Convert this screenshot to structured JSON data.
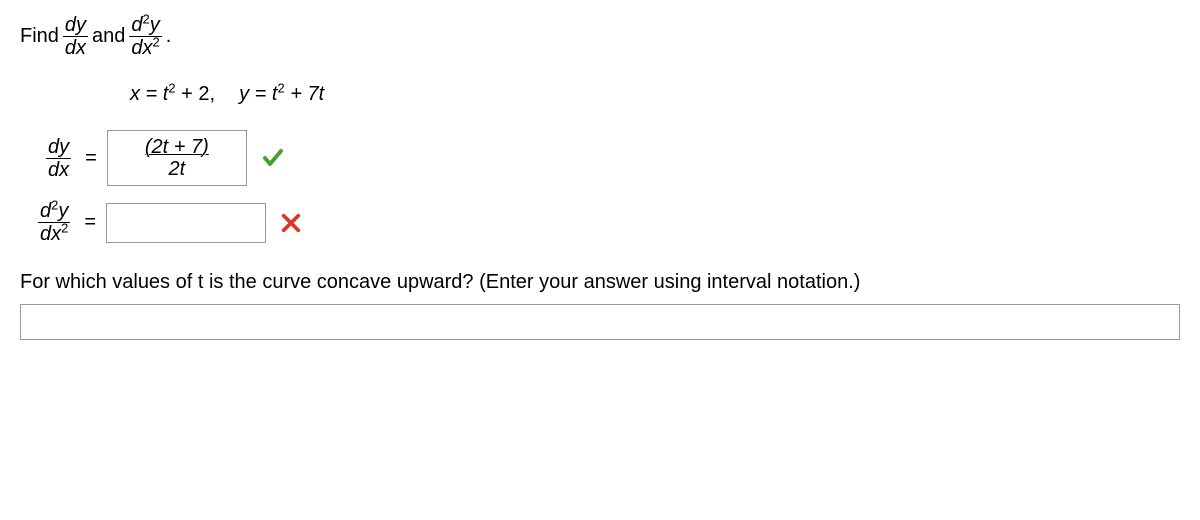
{
  "header": {
    "find": "Find",
    "and": "and",
    "period": "."
  },
  "derivs": {
    "dy": "dy",
    "dx": "dx",
    "d2y": "d",
    "sup2": "2",
    "y": "y",
    "dx2": "dx"
  },
  "given": {
    "x_eq": "x = t",
    "plus2": " + 2,",
    "y_eq": "y = t",
    "plus7t": " + 7t"
  },
  "answer1": {
    "num_open": "(",
    "num_expr": "2t + 7",
    "num_close": ")",
    "den": "2t"
  },
  "concave_prompt": "For which values of t is the curve concave upward? (Enter your answer using interval notation.)"
}
